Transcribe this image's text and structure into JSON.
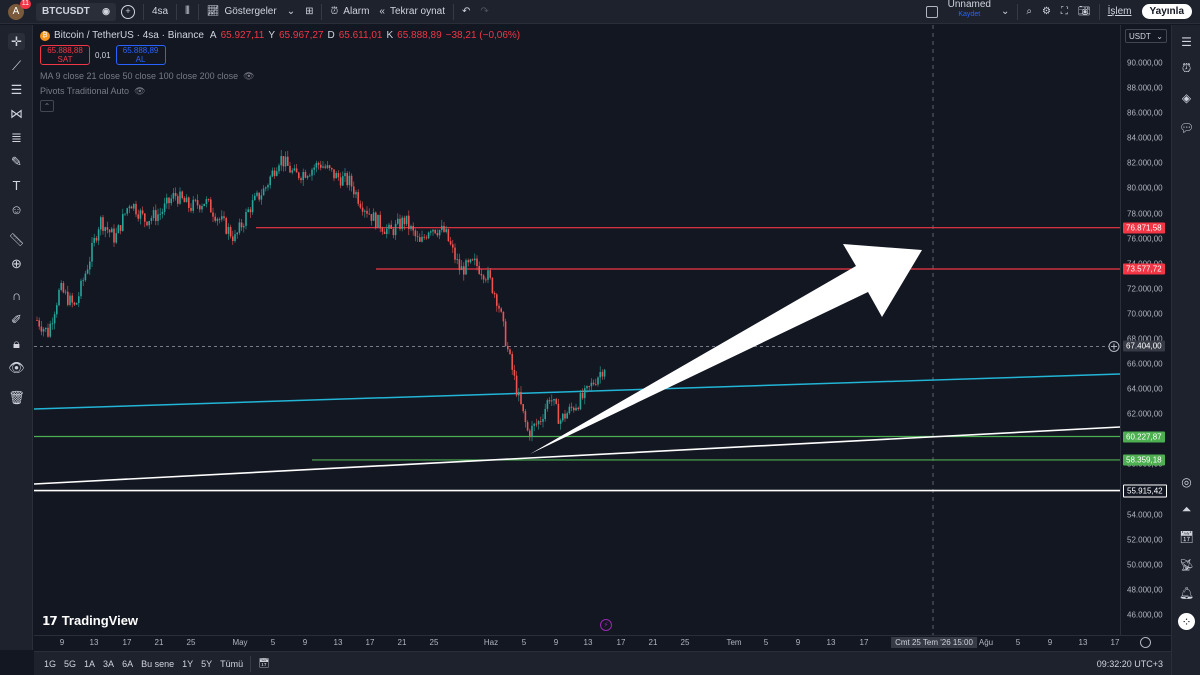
{
  "topbar": {
    "avatar_letter": "A",
    "notif_count": "11",
    "symbol": "BTCUSDT",
    "interval": "4sa",
    "indicators_label": "Göstergeler",
    "alarm_label": "Alarm",
    "replay_label": "Tekrar oynat",
    "layout_name": "Unnamed",
    "save_label": "Kaydet",
    "trade_label": "İşlem",
    "publish_label": "Yayınla"
  },
  "legend": {
    "title": "Bitcoin / TetherUS · 4sa · Binance",
    "open_label": "A",
    "open": "65.927,11",
    "high_label": "Y",
    "high": "65.967,27",
    "low_label": "D",
    "low": "65.611,01",
    "close_label": "K",
    "close": "65.888,89",
    "change": "−38,21 (−0,06%)",
    "sell_price": "65.888,88",
    "sell_label": "SAT",
    "spread": "0,01",
    "buy_price": "65.888,89",
    "buy_label": "AL",
    "ma_indicator": "MA 9 close 21 close 50 close 100 close 200 close",
    "pivots_indicator": "Pivots Traditional Auto"
  },
  "price_scale": {
    "currency": "USDT",
    "ticks": [
      "90.000,00",
      "88.000,00",
      "86.000,00",
      "84.000,00",
      "82.000,00",
      "80.000,00",
      "78.000,00",
      "76.000,00",
      "74.000,00",
      "72.000,00",
      "70.000,00",
      "68.000,00",
      "66.000,00",
      "64.000,00",
      "62.000,00",
      "60.000,00",
      "58.000,00",
      "56.000,00",
      "54.000,00",
      "52.000,00",
      "50.000,00",
      "48.000,00",
      "46.000,00"
    ],
    "labels": [
      {
        "value": "76.871,58",
        "color": "#f23645"
      },
      {
        "value": "73.577,72",
        "color": "#f23645"
      },
      {
        "value": "67.404,00",
        "color": "#363a45"
      },
      {
        "value": "60.227,87",
        "color": "#4caf50"
      },
      {
        "value": "58.359,18",
        "color": "#4caf50"
      },
      {
        "value": "55.915,42",
        "color": "#131722"
      }
    ]
  },
  "time_axis": {
    "ticks": [
      "9",
      "13",
      "17",
      "21",
      "25",
      "May",
      "5",
      "9",
      "13",
      "17",
      "21",
      "25",
      "Haz",
      "5",
      "9",
      "13",
      "17",
      "21",
      "25",
      "Tem",
      "5",
      "9",
      "13",
      "17",
      "Ağu",
      "5",
      "9",
      "13",
      "17"
    ],
    "cursor_label": "Cmt 25 Tem '26   15:00"
  },
  "bottombar": {
    "ranges": [
      "1G",
      "5G",
      "1A",
      "3A",
      "6A",
      "Bu sene",
      "1Y",
      "5Y",
      "Tümü"
    ],
    "clock": "09:32:20 UTC+3"
  },
  "watermark": "TradingView",
  "colors": {
    "bg": "#131722",
    "up": "#26a69a",
    "down": "#ef5350",
    "red_line": "#f23645",
    "green_line": "#4caf50",
    "cyan_line": "#22b5d6"
  }
}
